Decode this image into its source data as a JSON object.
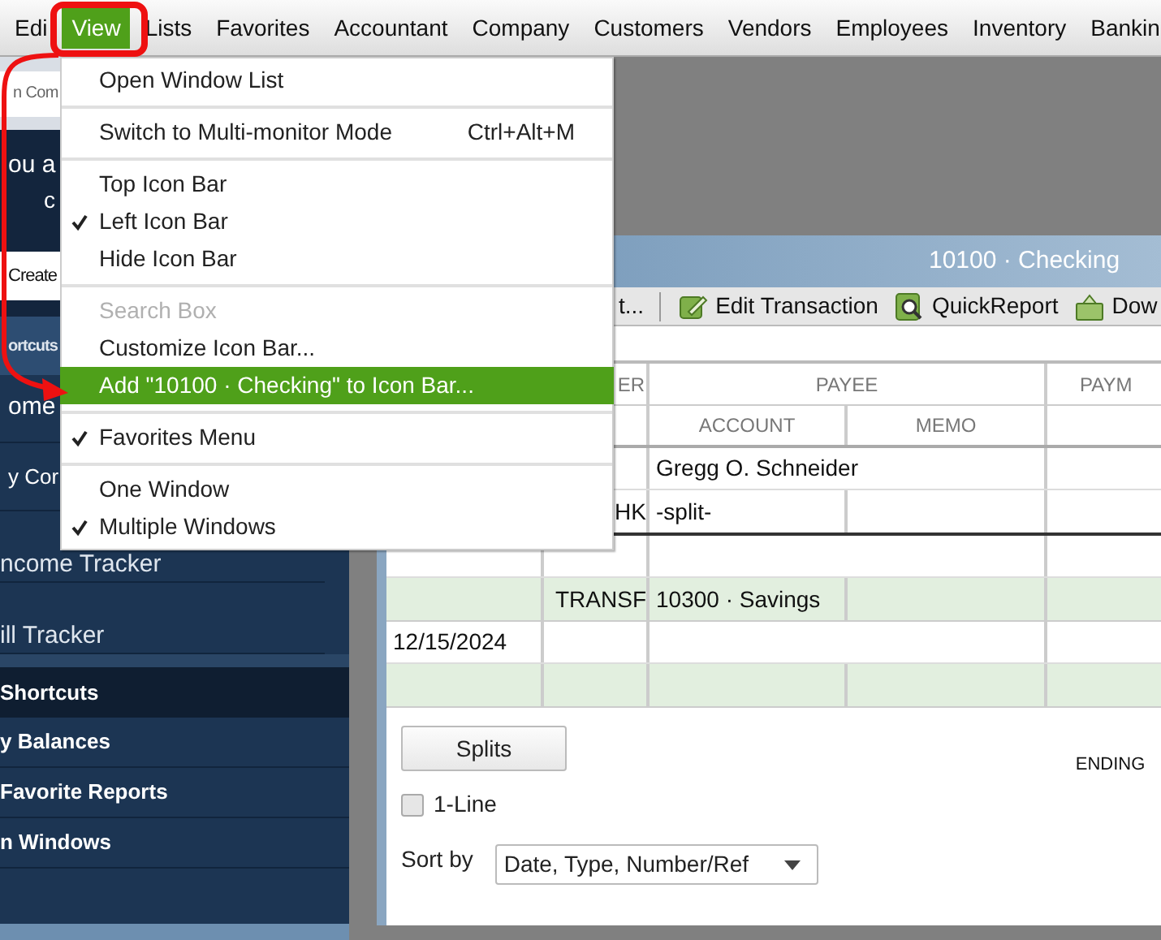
{
  "menu_bar": [
    {
      "label": "Edi",
      "selected": false
    },
    {
      "label": "View",
      "selected": true
    },
    {
      "label": "Lists",
      "selected": false
    },
    {
      "label": "Favorites",
      "selected": false
    },
    {
      "label": "Accountant",
      "selected": false
    },
    {
      "label": "Company",
      "selected": false
    },
    {
      "label": "Customers",
      "selected": false
    },
    {
      "label": "Vendors",
      "selected": false
    },
    {
      "label": "Employees",
      "selected": false
    },
    {
      "label": "Inventory",
      "selected": false
    },
    {
      "label": "Bankin",
      "selected": false
    }
  ],
  "view_menu": {
    "groups": [
      [
        {
          "label": "Open Window List",
          "checked": false,
          "disabled": false,
          "selected": false
        }
      ],
      [
        {
          "label": "Switch to Multi-monitor Mode",
          "shortcut": "Ctrl+Alt+M",
          "checked": false,
          "disabled": false,
          "selected": false
        }
      ],
      [
        {
          "label": "Top Icon Bar",
          "checked": false,
          "disabled": false,
          "selected": false
        },
        {
          "label": "Left Icon Bar",
          "checked": true,
          "disabled": false,
          "selected": false
        },
        {
          "label": "Hide Icon Bar",
          "checked": false,
          "disabled": false,
          "selected": false
        }
      ],
      [
        {
          "label": "Search Box",
          "checked": false,
          "disabled": true,
          "selected": false
        },
        {
          "label": "Customize Icon Bar...",
          "checked": false,
          "disabled": false,
          "selected": false
        },
        {
          "label": "Add \"10100 · Checking\" to Icon Bar...",
          "checked": false,
          "disabled": false,
          "selected": true
        }
      ],
      [
        {
          "label": "Favorites Menu",
          "checked": true,
          "disabled": false,
          "selected": false
        }
      ],
      [
        {
          "label": "One Window",
          "checked": false,
          "disabled": false,
          "selected": false
        },
        {
          "label": "Multiple Windows",
          "checked": true,
          "disabled": false,
          "selected": false
        }
      ]
    ]
  },
  "sidebar": {
    "search": {
      "placeholder": "n Com"
    },
    "banner": [
      "ou a",
      "c"
    ],
    "create_button": "Create",
    "tab": "ortcuts",
    "items": [
      "ome",
      "y Cor"
    ],
    "trackers": [
      "ncome Tracker",
      "ill Tracker"
    ],
    "section": "Shortcuts",
    "links": [
      "y Balances",
      "Favorite Reports",
      "n Windows"
    ]
  },
  "register": {
    "title": "10100 · Checking",
    "toolbar": [
      {
        "kind": "text",
        "label": "t..."
      },
      {
        "kind": "separator"
      },
      {
        "kind": "edit",
        "label": "Edit Transaction"
      },
      {
        "kind": "report",
        "label": "QuickReport"
      },
      {
        "kind": "download",
        "label": "Dow"
      }
    ],
    "header": {
      "number": "ER",
      "payee": "PAYEE",
      "payment": "PAYM",
      "account": "ACCOUNT",
      "memo": "MEMO"
    },
    "transactions": [
      {
        "selected": true,
        "shaded": false,
        "payee": "Gregg O. Schneider",
        "number": "HK",
        "account": "-split-"
      },
      {
        "selected": false,
        "shaded": true,
        "number": "TRANSF",
        "account": "10300 · Savings"
      },
      {
        "selected": false,
        "shaded": true,
        "date": "12/15/2024"
      }
    ],
    "splits_button": "Splits",
    "ending_label": "ENDING",
    "one_line": {
      "label": "1-Line",
      "checked": false
    },
    "sort": {
      "label": "Sort by",
      "value": "Date, Type, Number/Ref"
    }
  }
}
